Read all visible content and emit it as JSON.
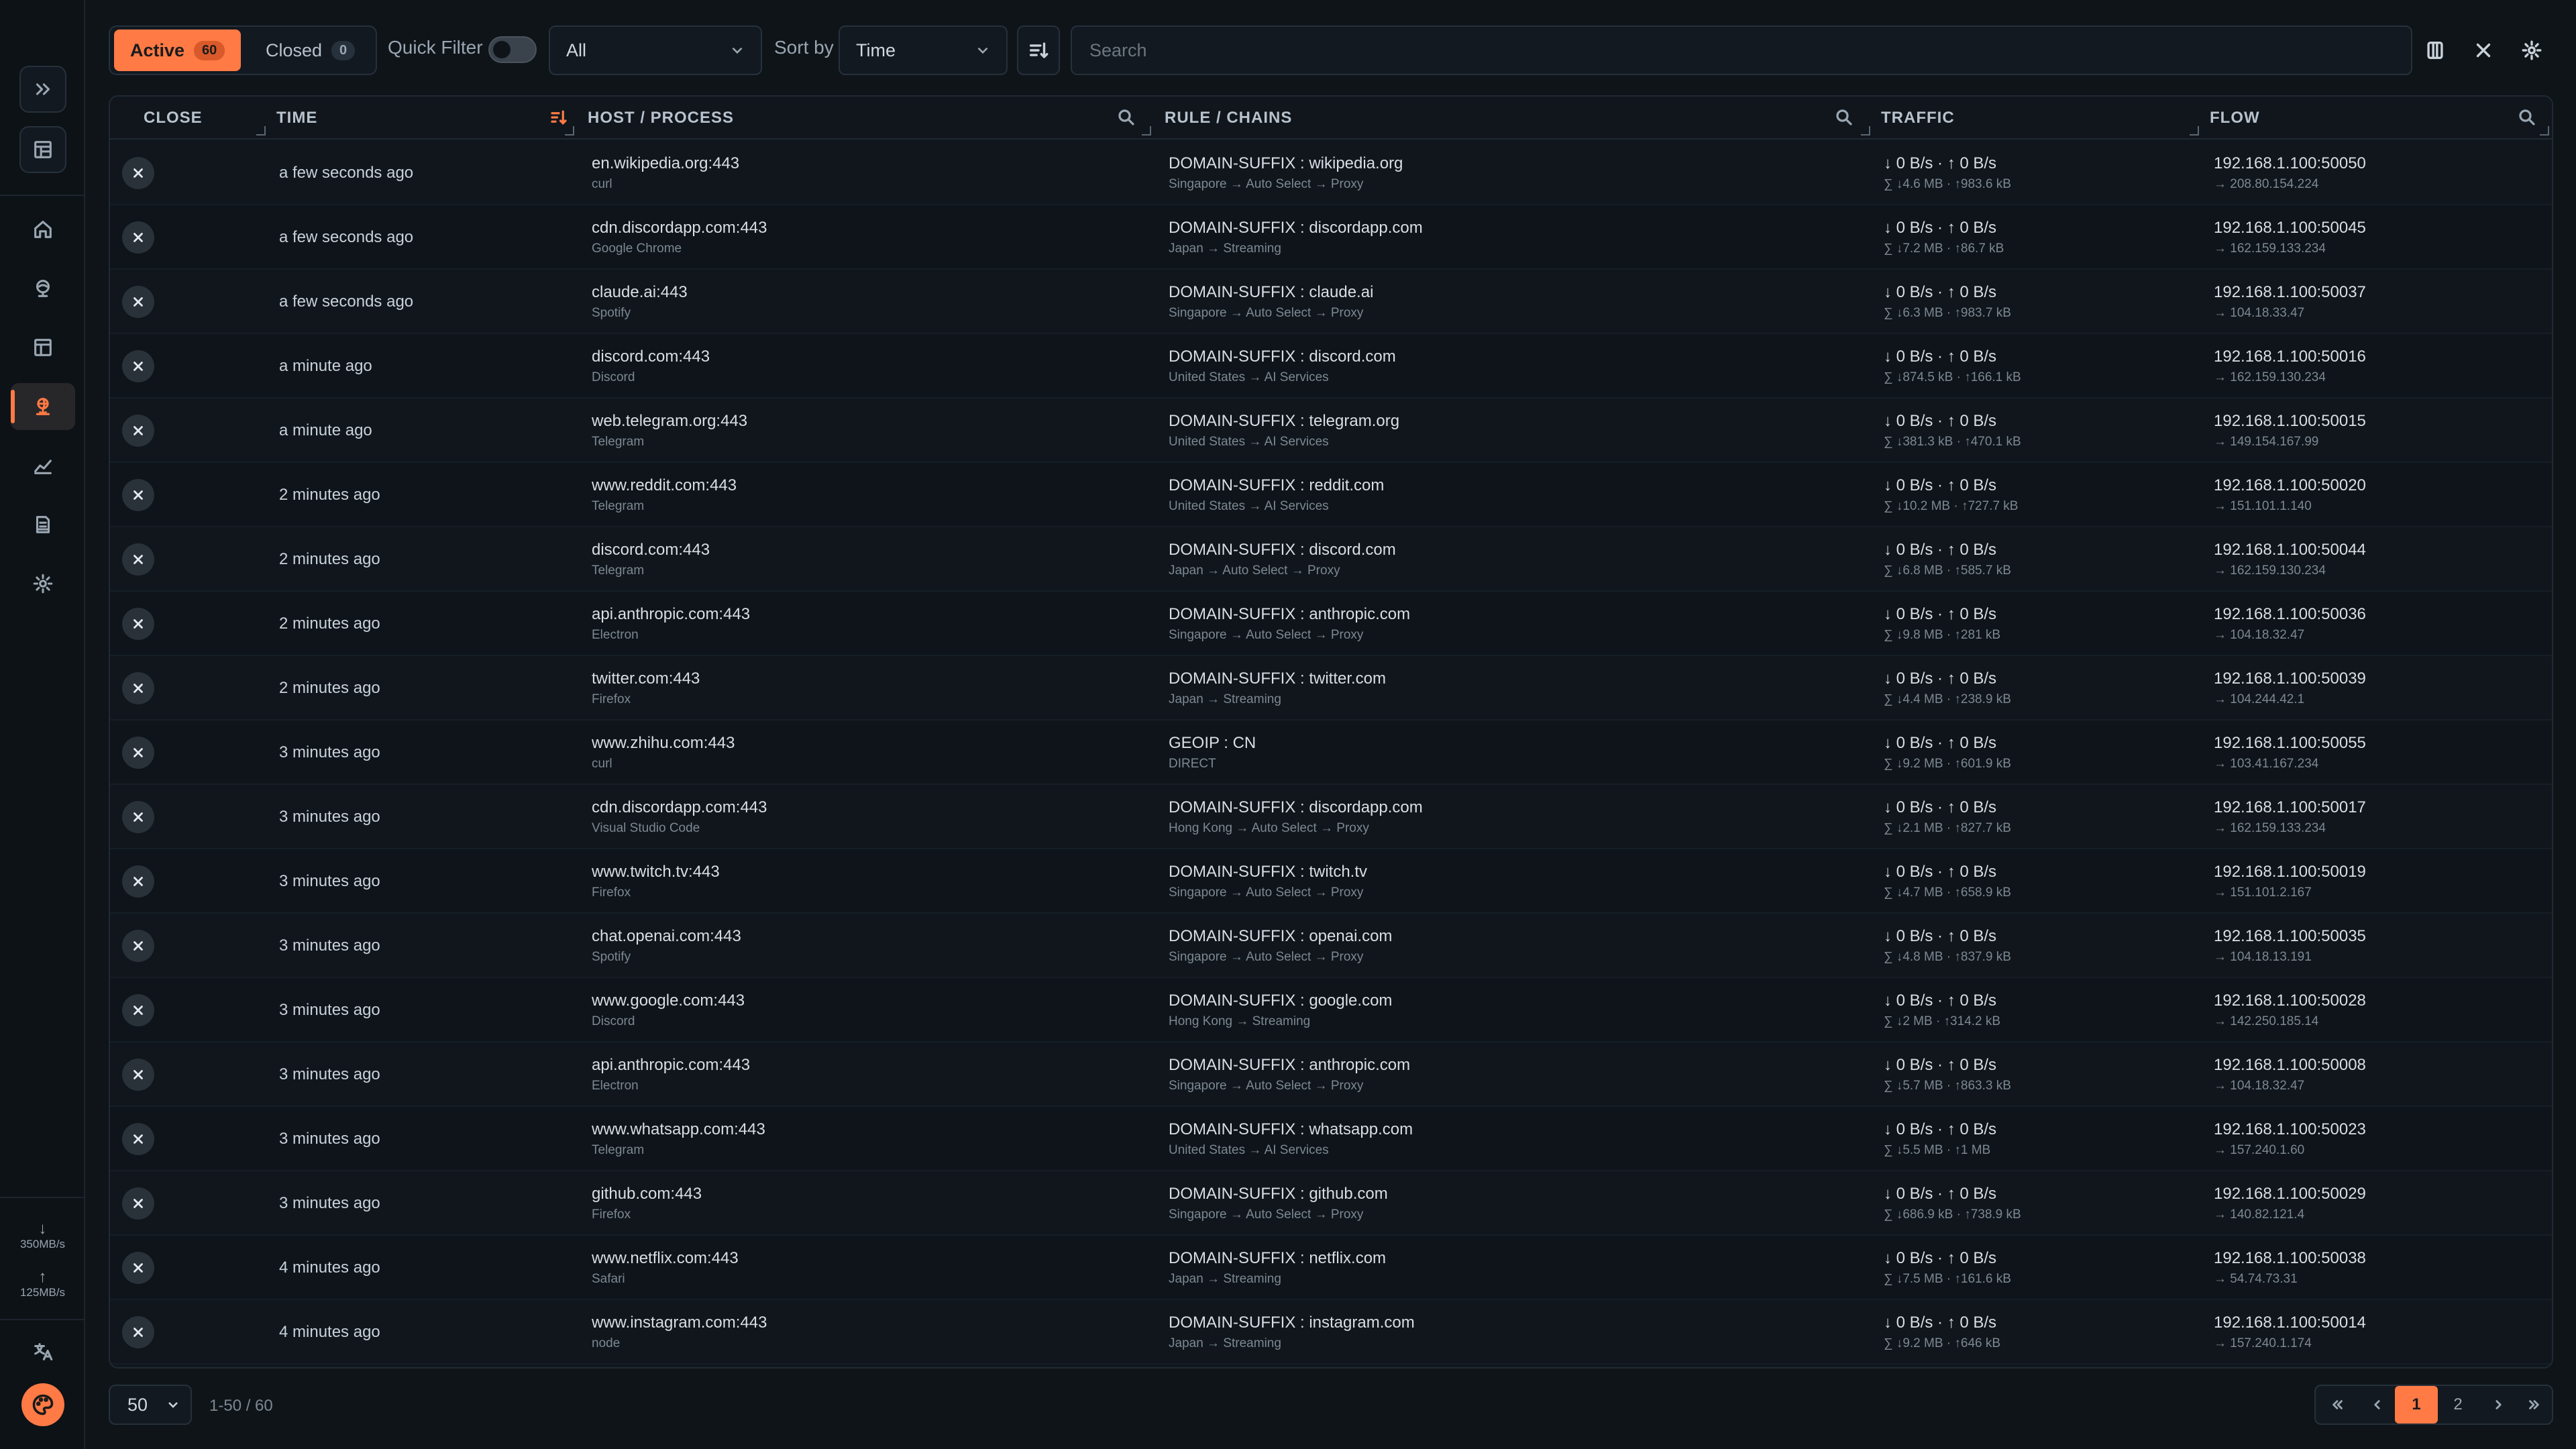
{
  "toolbar": {
    "active_label": "Active",
    "active_count": "60",
    "closed_label": "Closed",
    "closed_count": "0",
    "quick_filter_label": "Quick Filter",
    "filter_value": "All",
    "sort_by_label": "Sort by",
    "sort_value": "Time",
    "search_placeholder": "Search"
  },
  "sidebar": {
    "items": [
      "expand-icon",
      "layout-icon",
      "home-icon",
      "globe-icon",
      "list-icon",
      "connections-icon",
      "chart-icon",
      "logs-icon",
      "settings-icon"
    ],
    "active_item": "connections-icon",
    "download_speed": "350MB/s",
    "upload_speed": "125MB/s"
  },
  "table": {
    "headers": {
      "close": "CLOSE",
      "time": "TIME",
      "host": "HOST / PROCESS",
      "rule": "RULE / CHAINS",
      "traffic": "TRAFFIC",
      "flow": "FLOW"
    },
    "rows": [
      {
        "time": "a few seconds ago",
        "host": "en.wikipedia.org:443",
        "process": "curl",
        "rule": "DOMAIN-SUFFIX : wikipedia.org",
        "chain": "Singapore → Auto Select → Proxy",
        "speed": "↓ 0 B/s · ↑ 0 B/s",
        "total": "∑ ↓4.6 MB · ↑983.6 kB",
        "src": "192.168.1.100:50050",
        "dst": "→ 208.80.154.224"
      },
      {
        "time": "a few seconds ago",
        "host": "cdn.discordapp.com:443",
        "process": "Google Chrome",
        "rule": "DOMAIN-SUFFIX : discordapp.com",
        "chain": "Japan → Streaming",
        "speed": "↓ 0 B/s · ↑ 0 B/s",
        "total": "∑ ↓7.2 MB · ↑86.7 kB",
        "src": "192.168.1.100:50045",
        "dst": "→ 162.159.133.234"
      },
      {
        "time": "a few seconds ago",
        "host": "claude.ai:443",
        "process": "Spotify",
        "rule": "DOMAIN-SUFFIX : claude.ai",
        "chain": "Singapore → Auto Select → Proxy",
        "speed": "↓ 0 B/s · ↑ 0 B/s",
        "total": "∑ ↓6.3 MB · ↑983.7 kB",
        "src": "192.168.1.100:50037",
        "dst": "→ 104.18.33.47"
      },
      {
        "time": "a minute ago",
        "host": "discord.com:443",
        "process": "Discord",
        "rule": "DOMAIN-SUFFIX : discord.com",
        "chain": "United States → AI Services",
        "speed": "↓ 0 B/s · ↑ 0 B/s",
        "total": "∑ ↓874.5 kB · ↑166.1 kB",
        "src": "192.168.1.100:50016",
        "dst": "→ 162.159.130.234"
      },
      {
        "time": "a minute ago",
        "host": "web.telegram.org:443",
        "process": "Telegram",
        "rule": "DOMAIN-SUFFIX : telegram.org",
        "chain": "United States → AI Services",
        "speed": "↓ 0 B/s · ↑ 0 B/s",
        "total": "∑ ↓381.3 kB · ↑470.1 kB",
        "src": "192.168.1.100:50015",
        "dst": "→ 149.154.167.99"
      },
      {
        "time": "2 minutes ago",
        "host": "www.reddit.com:443",
        "process": "Telegram",
        "rule": "DOMAIN-SUFFIX : reddit.com",
        "chain": "United States → AI Services",
        "speed": "↓ 0 B/s · ↑ 0 B/s",
        "total": "∑ ↓10.2 MB · ↑727.7 kB",
        "src": "192.168.1.100:50020",
        "dst": "→ 151.101.1.140"
      },
      {
        "time": "2 minutes ago",
        "host": "discord.com:443",
        "process": "Telegram",
        "rule": "DOMAIN-SUFFIX : discord.com",
        "chain": "Japan → Auto Select → Proxy",
        "speed": "↓ 0 B/s · ↑ 0 B/s",
        "total": "∑ ↓6.8 MB · ↑585.7 kB",
        "src": "192.168.1.100:50044",
        "dst": "→ 162.159.130.234"
      },
      {
        "time": "2 minutes ago",
        "host": "api.anthropic.com:443",
        "process": "Electron",
        "rule": "DOMAIN-SUFFIX : anthropic.com",
        "chain": "Singapore → Auto Select → Proxy",
        "speed": "↓ 0 B/s · ↑ 0 B/s",
        "total": "∑ ↓9.8 MB · ↑281 kB",
        "src": "192.168.1.100:50036",
        "dst": "→ 104.18.32.47"
      },
      {
        "time": "2 minutes ago",
        "host": "twitter.com:443",
        "process": "Firefox",
        "rule": "DOMAIN-SUFFIX : twitter.com",
        "chain": "Japan → Streaming",
        "speed": "↓ 0 B/s · ↑ 0 B/s",
        "total": "∑ ↓4.4 MB · ↑238.9 kB",
        "src": "192.168.1.100:50039",
        "dst": "→ 104.244.42.1"
      },
      {
        "time": "3 minutes ago",
        "host": "www.zhihu.com:443",
        "process": "curl",
        "rule": "GEOIP : CN",
        "chain": "DIRECT",
        "speed": "↓ 0 B/s · ↑ 0 B/s",
        "total": "∑ ↓9.2 MB · ↑601.9 kB",
        "src": "192.168.1.100:50055",
        "dst": "→ 103.41.167.234"
      },
      {
        "time": "3 minutes ago",
        "host": "cdn.discordapp.com:443",
        "process": "Visual Studio Code",
        "rule": "DOMAIN-SUFFIX : discordapp.com",
        "chain": "Hong Kong → Auto Select → Proxy",
        "speed": "↓ 0 B/s · ↑ 0 B/s",
        "total": "∑ ↓2.1 MB · ↑827.7 kB",
        "src": "192.168.1.100:50017",
        "dst": "→ 162.159.133.234"
      },
      {
        "time": "3 minutes ago",
        "host": "www.twitch.tv:443",
        "process": "Firefox",
        "rule": "DOMAIN-SUFFIX : twitch.tv",
        "chain": "Singapore → Auto Select → Proxy",
        "speed": "↓ 0 B/s · ↑ 0 B/s",
        "total": "∑ ↓4.7 MB · ↑658.9 kB",
        "src": "192.168.1.100:50019",
        "dst": "→ 151.101.2.167"
      },
      {
        "time": "3 minutes ago",
        "host": "chat.openai.com:443",
        "process": "Spotify",
        "rule": "DOMAIN-SUFFIX : openai.com",
        "chain": "Singapore → Auto Select → Proxy",
        "speed": "↓ 0 B/s · ↑ 0 B/s",
        "total": "∑ ↓4.8 MB · ↑837.9 kB",
        "src": "192.168.1.100:50035",
        "dst": "→ 104.18.13.191"
      },
      {
        "time": "3 minutes ago",
        "host": "www.google.com:443",
        "process": "Discord",
        "rule": "DOMAIN-SUFFIX : google.com",
        "chain": "Hong Kong → Streaming",
        "speed": "↓ 0 B/s · ↑ 0 B/s",
        "total": "∑ ↓2 MB · ↑314.2 kB",
        "src": "192.168.1.100:50028",
        "dst": "→ 142.250.185.14"
      },
      {
        "time": "3 minutes ago",
        "host": "api.anthropic.com:443",
        "process": "Electron",
        "rule": "DOMAIN-SUFFIX : anthropic.com",
        "chain": "Singapore → Auto Select → Proxy",
        "speed": "↓ 0 B/s · ↑ 0 B/s",
        "total": "∑ ↓5.7 MB · ↑863.3 kB",
        "src": "192.168.1.100:50008",
        "dst": "→ 104.18.32.47"
      },
      {
        "time": "3 minutes ago",
        "host": "www.whatsapp.com:443",
        "process": "Telegram",
        "rule": "DOMAIN-SUFFIX : whatsapp.com",
        "chain": "United States → AI Services",
        "speed": "↓ 0 B/s · ↑ 0 B/s",
        "total": "∑ ↓5.5 MB · ↑1 MB",
        "src": "192.168.1.100:50023",
        "dst": "→ 157.240.1.60"
      },
      {
        "time": "3 minutes ago",
        "host": "github.com:443",
        "process": "Firefox",
        "rule": "DOMAIN-SUFFIX : github.com",
        "chain": "Singapore → Auto Select → Proxy",
        "speed": "↓ 0 B/s · ↑ 0 B/s",
        "total": "∑ ↓686.9 kB · ↑738.9 kB",
        "src": "192.168.1.100:50029",
        "dst": "→ 140.82.121.4"
      },
      {
        "time": "4 minutes ago",
        "host": "www.netflix.com:443",
        "process": "Safari",
        "rule": "DOMAIN-SUFFIX : netflix.com",
        "chain": "Japan → Streaming",
        "speed": "↓ 0 B/s · ↑ 0 B/s",
        "total": "∑ ↓7.5 MB · ↑161.6 kB",
        "src": "192.168.1.100:50038",
        "dst": "→ 54.74.73.31"
      },
      {
        "time": "4 minutes ago",
        "host": "www.instagram.com:443",
        "process": "node",
        "rule": "DOMAIN-SUFFIX : instagram.com",
        "chain": "Japan → Streaming",
        "speed": "↓ 0 B/s · ↑ 0 B/s",
        "total": "∑ ↓9.2 MB · ↑646 kB",
        "src": "192.168.1.100:50014",
        "dst": "→ 157.240.1.174"
      }
    ]
  },
  "footer": {
    "page_size": "50",
    "range": "1-50 / 60",
    "pages": [
      "1",
      "2"
    ],
    "current_page": "1"
  },
  "colors": {
    "accent": "#ff7a45",
    "background": "#0f1419",
    "border": "#26313b"
  }
}
